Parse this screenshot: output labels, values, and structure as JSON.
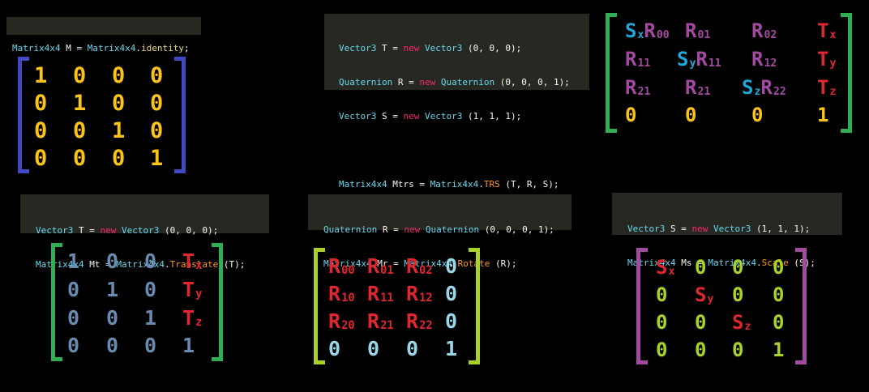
{
  "colors": {
    "yellow": "#fcc419",
    "blue": "#4348c4",
    "green": "#2fae55",
    "purple": "#a24aa0",
    "red": "#e0262f",
    "cyan": "#1ea7d9",
    "slate": "#6a8ab0",
    "lime": "#aad12a",
    "code_bg": "#272822"
  },
  "code_identity": {
    "line1": {
      "a": "Matrix4x4",
      "b": " M = ",
      "c": "Matrix4x4",
      "d": ".",
      "e": "identity",
      "f": ";"
    }
  },
  "code_trs": {
    "l1": {
      "t1": "Vector3",
      "p1": " T = ",
      "k1": "new",
      "p2": " ",
      "t2": "Vector3",
      "p3": " (0, 0, 0);"
    },
    "l2": {
      "t1": "Quaternion",
      "p1": " R = ",
      "k1": "new",
      "p2": " ",
      "t2": "Quaternion",
      "p3": " (0, 0, 0, 1);"
    },
    "l3": {
      "t1": "Vector3",
      "p1": " S = ",
      "k1": "new",
      "p2": " ",
      "t2": "Vector3",
      "p3": " (1, 1, 1);"
    },
    "l5": {
      "t1": "Matrix4x4",
      "p1": " Mtrs = ",
      "t2": "Matrix4x4",
      "p2": ".",
      "f1": "TRS",
      "p3": " (T, R, S);"
    }
  },
  "code_translate": {
    "l1": {
      "t1": "Vector3",
      "p1": " T = ",
      "k1": "new",
      "p2": " ",
      "t2": "Vector3",
      "p3": " (0, 0, 0);"
    },
    "l2": {
      "t1": "Matrix4x4",
      "p1": " Mt = ",
      "t2": "Matrix4x4",
      "p2": ".",
      "f1": "Translate",
      "p3": " (T);"
    }
  },
  "code_rotate": {
    "l1": {
      "t1": "Quaternion",
      "p1": " R = ",
      "k1": "new",
      "p2": " ",
      "t2": "Quaternion",
      "p3": " (0, 0, 0, 1);"
    },
    "l2": {
      "t1": "Matrix4x4",
      "p1": " Mr = ",
      "t2": "Matrix4x4",
      "p2": ".",
      "f1": "Rotate",
      "p3": " (R);"
    }
  },
  "code_scale": {
    "l1": {
      "t1": "Vector3",
      "p1": " S = ",
      "k1": "new",
      "p2": " ",
      "t2": "Vector3",
      "p3": " (1, 1, 1);"
    },
    "l2": {
      "t1": "Matrix4x4",
      "p1": " Ms = ",
      "t2": "Matrix4x4",
      "p2": ".",
      "f1": "Scale",
      "p3": " (S);"
    }
  },
  "matrices": [
    {
      "id": "identity",
      "bracket_color": "blue",
      "cells": [
        [
          {
            "t": "1",
            "c": "yellow"
          },
          {
            "t": "0",
            "c": "yellow"
          },
          {
            "t": "0",
            "c": "yellow"
          },
          {
            "t": "0",
            "c": "yellow"
          }
        ],
        [
          {
            "t": "0",
            "c": "yellow"
          },
          {
            "t": "1",
            "c": "yellow"
          },
          {
            "t": "0",
            "c": "yellow"
          },
          {
            "t": "0",
            "c": "yellow"
          }
        ],
        [
          {
            "t": "0",
            "c": "yellow"
          },
          {
            "t": "0",
            "c": "yellow"
          },
          {
            "t": "1",
            "c": "yellow"
          },
          {
            "t": "0",
            "c": "yellow"
          }
        ],
        [
          {
            "t": "0",
            "c": "yellow"
          },
          {
            "t": "0",
            "c": "yellow"
          },
          {
            "t": "0",
            "c": "yellow"
          },
          {
            "t": "1",
            "c": "yellow"
          }
        ]
      ]
    },
    {
      "id": "trs",
      "bracket_color": "green",
      "cells": [
        [
          {
            "parts": [
              {
                "t": "S",
                "c": "cyan"
              },
              {
                "t": "x",
                "c": "cyan",
                "sub": true
              },
              {
                "t": "R",
                "c": "purple"
              },
              {
                "t": "00",
                "c": "purple",
                "sub": true
              }
            ]
          },
          {
            "parts": [
              {
                "t": "R",
                "c": "purple"
              },
              {
                "t": "01",
                "c": "purple",
                "sub": true
              }
            ]
          },
          {
            "parts": [
              {
                "t": "R",
                "c": "purple"
              },
              {
                "t": "02",
                "c": "purple",
                "sub": true
              }
            ]
          },
          {
            "parts": [
              {
                "t": "T",
                "c": "red"
              },
              {
                "t": "x",
                "c": "red",
                "sub": true
              }
            ]
          }
        ],
        [
          {
            "parts": [
              {
                "t": "R",
                "c": "purple"
              },
              {
                "t": "11",
                "c": "purple",
                "sub": true
              }
            ]
          },
          {
            "parts": [
              {
                "t": "S",
                "c": "cyan"
              },
              {
                "t": "y",
                "c": "cyan",
                "sub": true
              },
              {
                "t": "R",
                "c": "purple"
              },
              {
                "t": "11",
                "c": "purple",
                "sub": true
              }
            ]
          },
          {
            "parts": [
              {
                "t": "R",
                "c": "purple"
              },
              {
                "t": "12",
                "c": "purple",
                "sub": true
              }
            ]
          },
          {
            "parts": [
              {
                "t": "T",
                "c": "red"
              },
              {
                "t": "y",
                "c": "red",
                "sub": true
              }
            ]
          }
        ],
        [
          {
            "parts": [
              {
                "t": "R",
                "c": "purple"
              },
              {
                "t": "21",
                "c": "purple",
                "sub": true
              }
            ]
          },
          {
            "parts": [
              {
                "t": "R",
                "c": "purple"
              },
              {
                "t": "21",
                "c": "purple",
                "sub": true
              }
            ]
          },
          {
            "parts": [
              {
                "t": "S",
                "c": "cyan"
              },
              {
                "t": "z",
                "c": "cyan",
                "sub": true
              },
              {
                "t": "R",
                "c": "purple"
              },
              {
                "t": "22",
                "c": "purple",
                "sub": true
              }
            ]
          },
          {
            "parts": [
              {
                "t": "T",
                "c": "red"
              },
              {
                "t": "z",
                "c": "red",
                "sub": true
              }
            ]
          }
        ],
        [
          {
            "t": "0",
            "c": "yellow"
          },
          {
            "t": "0",
            "c": "yellow"
          },
          {
            "t": "0",
            "c": "yellow"
          },
          {
            "t": "1",
            "c": "yellow"
          }
        ]
      ]
    },
    {
      "id": "translate",
      "bracket_color": "green",
      "cells": [
        [
          {
            "t": "1",
            "c": "slate"
          },
          {
            "t": "0",
            "c": "slate"
          },
          {
            "t": "0",
            "c": "slate"
          },
          {
            "parts": [
              {
                "t": "T",
                "c": "red"
              },
              {
                "t": "x",
                "c": "red",
                "sub": true
              }
            ]
          }
        ],
        [
          {
            "t": "0",
            "c": "slate"
          },
          {
            "t": "1",
            "c": "slate"
          },
          {
            "t": "0",
            "c": "slate"
          },
          {
            "parts": [
              {
                "t": "T",
                "c": "red"
              },
              {
                "t": "y",
                "c": "red",
                "sub": true
              }
            ]
          }
        ],
        [
          {
            "t": "0",
            "c": "slate"
          },
          {
            "t": "0",
            "c": "slate"
          },
          {
            "t": "1",
            "c": "slate"
          },
          {
            "parts": [
              {
                "t": "T",
                "c": "red"
              },
              {
                "t": "z",
                "c": "red",
                "sub": true
              }
            ]
          }
        ],
        [
          {
            "t": "0",
            "c": "slate"
          },
          {
            "t": "0",
            "c": "slate"
          },
          {
            "t": "0",
            "c": "slate"
          },
          {
            "t": "1",
            "c": "slate"
          }
        ]
      ]
    },
    {
      "id": "rotate",
      "bracket_color": "lime",
      "cells": [
        [
          {
            "parts": [
              {
                "t": "R",
                "c": "red"
              },
              {
                "t": "00",
                "c": "red",
                "sub": true
              }
            ]
          },
          {
            "parts": [
              {
                "t": "R",
                "c": "red"
              },
              {
                "t": "01",
                "c": "red",
                "sub": true
              }
            ]
          },
          {
            "parts": [
              {
                "t": "R",
                "c": "red"
              },
              {
                "t": "02",
                "c": "red",
                "sub": true
              }
            ]
          },
          {
            "t": "0",
            "c": "lightblue"
          }
        ],
        [
          {
            "parts": [
              {
                "t": "R",
                "c": "red"
              },
              {
                "t": "10",
                "c": "red",
                "sub": true
              }
            ]
          },
          {
            "parts": [
              {
                "t": "R",
                "c": "red"
              },
              {
                "t": "11",
                "c": "red",
                "sub": true
              }
            ]
          },
          {
            "parts": [
              {
                "t": "R",
                "c": "red"
              },
              {
                "t": "12",
                "c": "red",
                "sub": true
              }
            ]
          },
          {
            "t": "0",
            "c": "lightblue"
          }
        ],
        [
          {
            "parts": [
              {
                "t": "R",
                "c": "red"
              },
              {
                "t": "20",
                "c": "red",
                "sub": true
              }
            ]
          },
          {
            "parts": [
              {
                "t": "R",
                "c": "red"
              },
              {
                "t": "21",
                "c": "red",
                "sub": true
              }
            ]
          },
          {
            "parts": [
              {
                "t": "R",
                "c": "red"
              },
              {
                "t": "22",
                "c": "red",
                "sub": true
              }
            ]
          },
          {
            "t": "0",
            "c": "lightblue"
          }
        ],
        [
          {
            "t": "0",
            "c": "lightblue"
          },
          {
            "t": "0",
            "c": "lightblue"
          },
          {
            "t": "0",
            "c": "lightblue"
          },
          {
            "t": "1",
            "c": "lightblue"
          }
        ]
      ]
    },
    {
      "id": "scale",
      "bracket_color": "purple",
      "cells": [
        [
          {
            "parts": [
              {
                "t": "S",
                "c": "red"
              },
              {
                "t": "x",
                "c": "red",
                "sub": true
              }
            ]
          },
          {
            "t": "0",
            "c": "lime"
          },
          {
            "t": "0",
            "c": "lime"
          },
          {
            "t": "0",
            "c": "lime"
          }
        ],
        [
          {
            "t": "0",
            "c": "lime"
          },
          {
            "parts": [
              {
                "t": "S",
                "c": "red"
              },
              {
                "t": "y",
                "c": "red",
                "sub": true
              }
            ]
          },
          {
            "t": "0",
            "c": "lime"
          },
          {
            "t": "0",
            "c": "lime"
          }
        ],
        [
          {
            "t": "0",
            "c": "lime"
          },
          {
            "t": "0",
            "c": "lime"
          },
          {
            "parts": [
              {
                "t": "S",
                "c": "red"
              },
              {
                "t": "z",
                "c": "red",
                "sub": true
              }
            ]
          },
          {
            "t": "0",
            "c": "lime"
          }
        ],
        [
          {
            "t": "0",
            "c": "lime"
          },
          {
            "t": "0",
            "c": "lime"
          },
          {
            "t": "0",
            "c": "lime"
          },
          {
            "t": "1",
            "c": "lime"
          }
        ]
      ]
    }
  ]
}
